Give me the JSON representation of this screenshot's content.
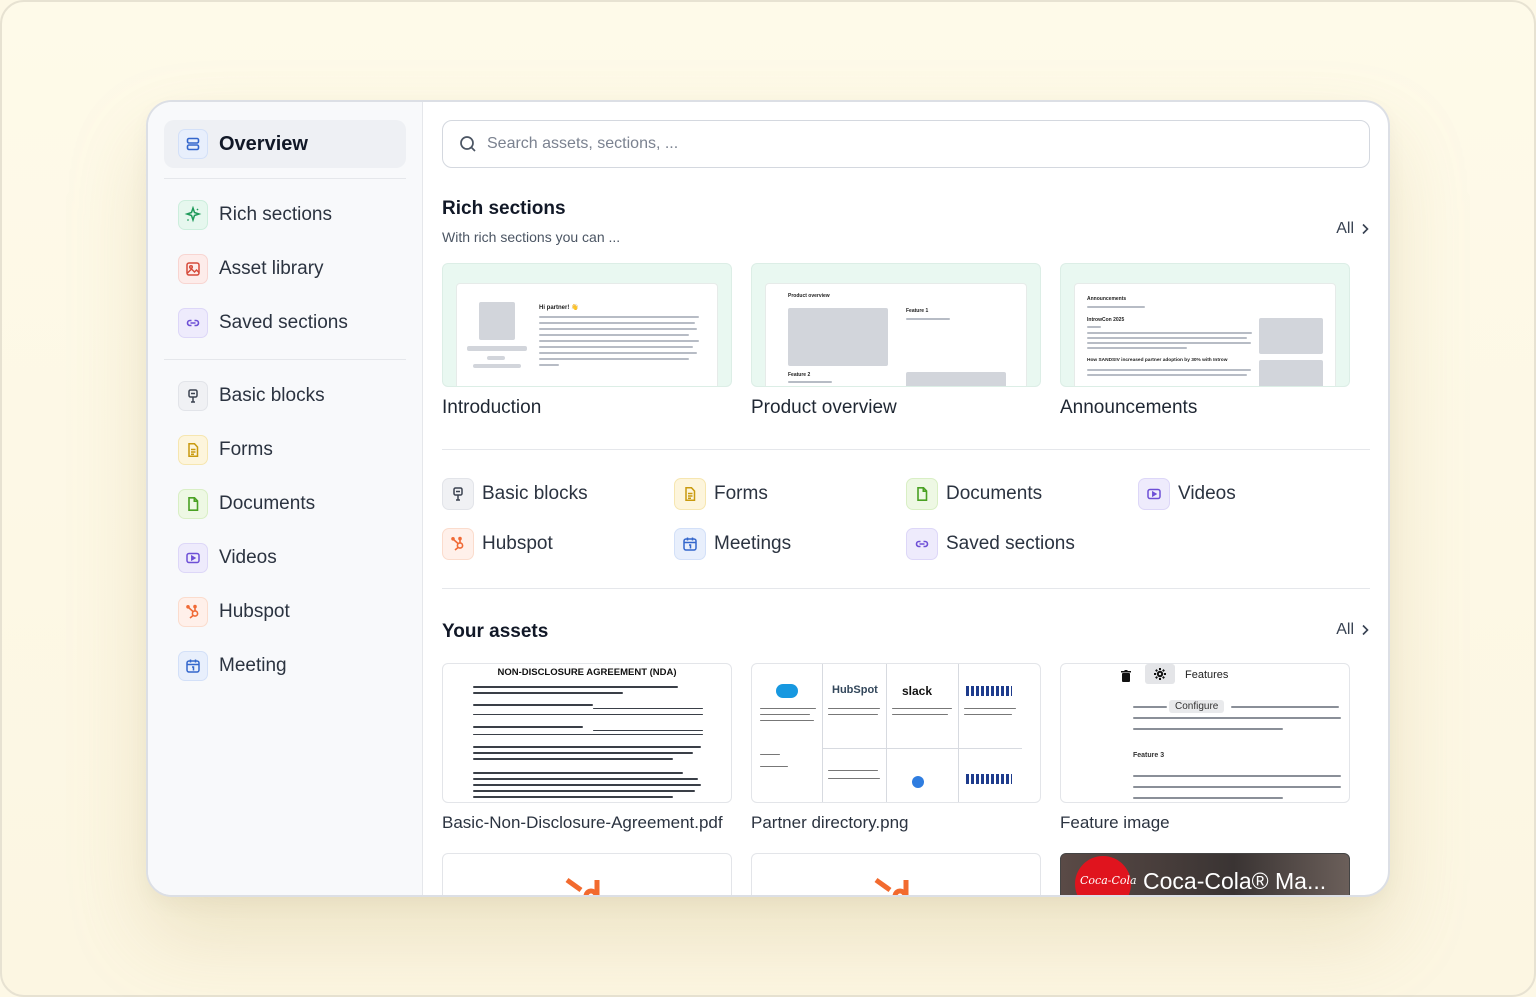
{
  "sidebar": {
    "overview": "Overview",
    "group1": [
      "Rich sections",
      "Asset library",
      "Saved sections"
    ],
    "group2": [
      "Basic blocks",
      "Forms",
      "Documents",
      "Videos",
      "Hubspot",
      "Meeting"
    ]
  },
  "search": {
    "placeholder": "Search assets, sections, ..."
  },
  "rich": {
    "title": "Rich sections",
    "subtitle": "With rich sections you can ...",
    "all": "All",
    "cards": [
      "Introduction",
      "Product overview",
      "Announcements"
    ],
    "thumb_text": {
      "intro_heading": "Hi partner! 👋",
      "product_heading": "Product overview",
      "product_feature1": "Feature 1",
      "product_feature2": "Feature 2",
      "ann_heading": "Announcements",
      "ann_item1": "IntrowCon 2025",
      "ann_item2": "How SANDSIV increased partner adoption by 30% with Introw"
    }
  },
  "categories": [
    "Basic blocks",
    "Forms",
    "Documents",
    "Videos",
    "Hubspot",
    "Meetings",
    "Saved sections"
  ],
  "assets": {
    "title": "Your assets",
    "all": "All",
    "items": [
      "Basic-Non-Disclosure-Agreement.pdf",
      "Partner directory.png",
      "Feature image"
    ],
    "nda_heading": "NON-DISCLOSURE AGREEMENT (NDA)",
    "feature_title": "Features",
    "feature_configure": "Configure",
    "feature_sub": "Feature 3",
    "partner_logos": [
      "HubSpot",
      "slack"
    ],
    "video_title": "Coca-Cola® Ma..."
  }
}
